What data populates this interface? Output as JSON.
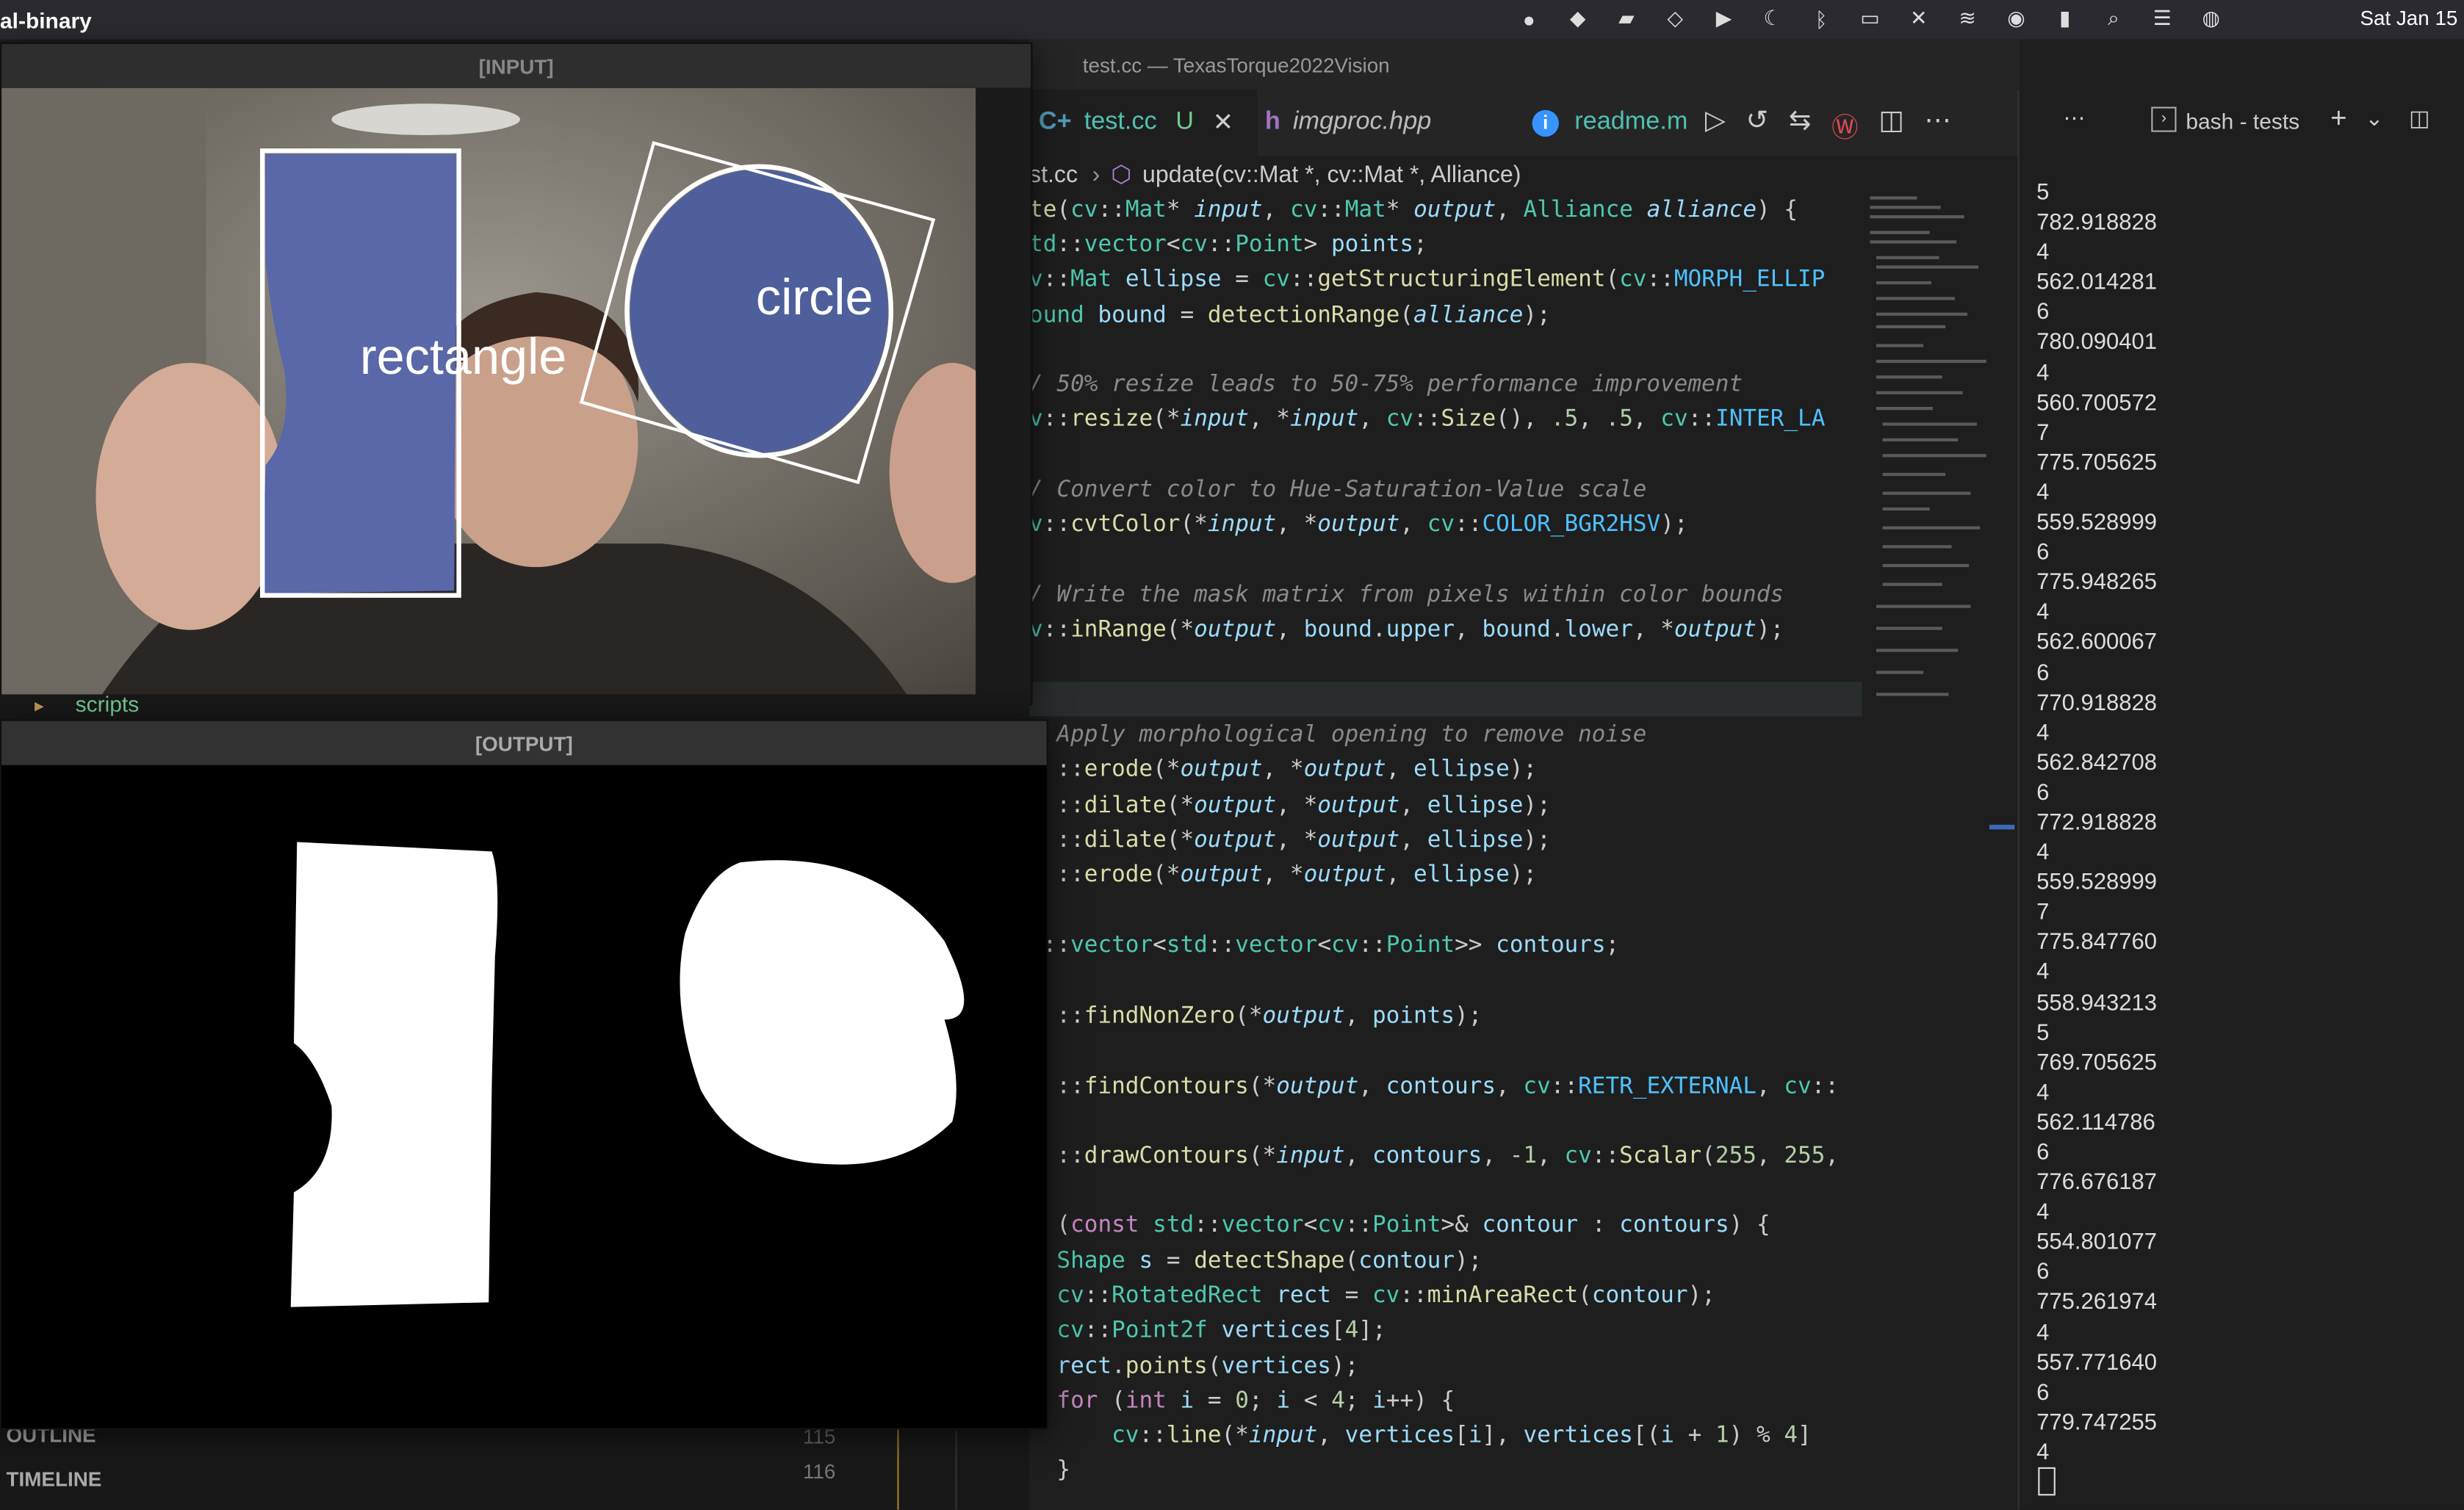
{
  "menubar": {
    "app_name": "al-binary",
    "date": "Sat Jan 15"
  },
  "editor": {
    "window_title": "test.cc — TexasTorque2022Vision",
    "tabs": [
      {
        "label": "test.cc",
        "badge": "U"
      },
      {
        "label": "imgproc.hpp"
      },
      {
        "label": "readme.m"
      }
    ],
    "breadcrumb_file": "st.cc",
    "breadcrumb_symbol": "update(cv::Mat *, cv::Mat *, Alliance)"
  },
  "terminal": {
    "title": "bash - tests",
    "output": [
      "5",
      "782.918828",
      "4",
      "562.014281",
      "6",
      "780.090401",
      "4",
      "560.700572",
      "7",
      "775.705625",
      "4",
      "559.528999",
      "6",
      "775.948265",
      "4",
      "562.600067",
      "6",
      "770.918828",
      "4",
      "562.842708",
      "6",
      "772.918828",
      "4",
      "559.528999",
      "7",
      "775.847760",
      "4",
      "558.943213",
      "5",
      "769.705625",
      "4",
      "562.114786",
      "6",
      "776.676187",
      "4",
      "554.801077",
      "6",
      "775.261974",
      "4",
      "557.771640",
      "6",
      "779.747255",
      "4"
    ]
  },
  "windows": {
    "input_title": "[INPUT]",
    "output_title": "[OUTPUT]",
    "label_rectangle": "rectangle",
    "label_circle": "circle"
  },
  "sidebar": {
    "folder": "scripts",
    "outline": "OUTLINE",
    "timeline": "TIMELINE",
    "line_numbers": [
      "115",
      "116"
    ]
  },
  "colors": {
    "accent": "#4ec1b0",
    "bg": "#1e1e1e"
  }
}
